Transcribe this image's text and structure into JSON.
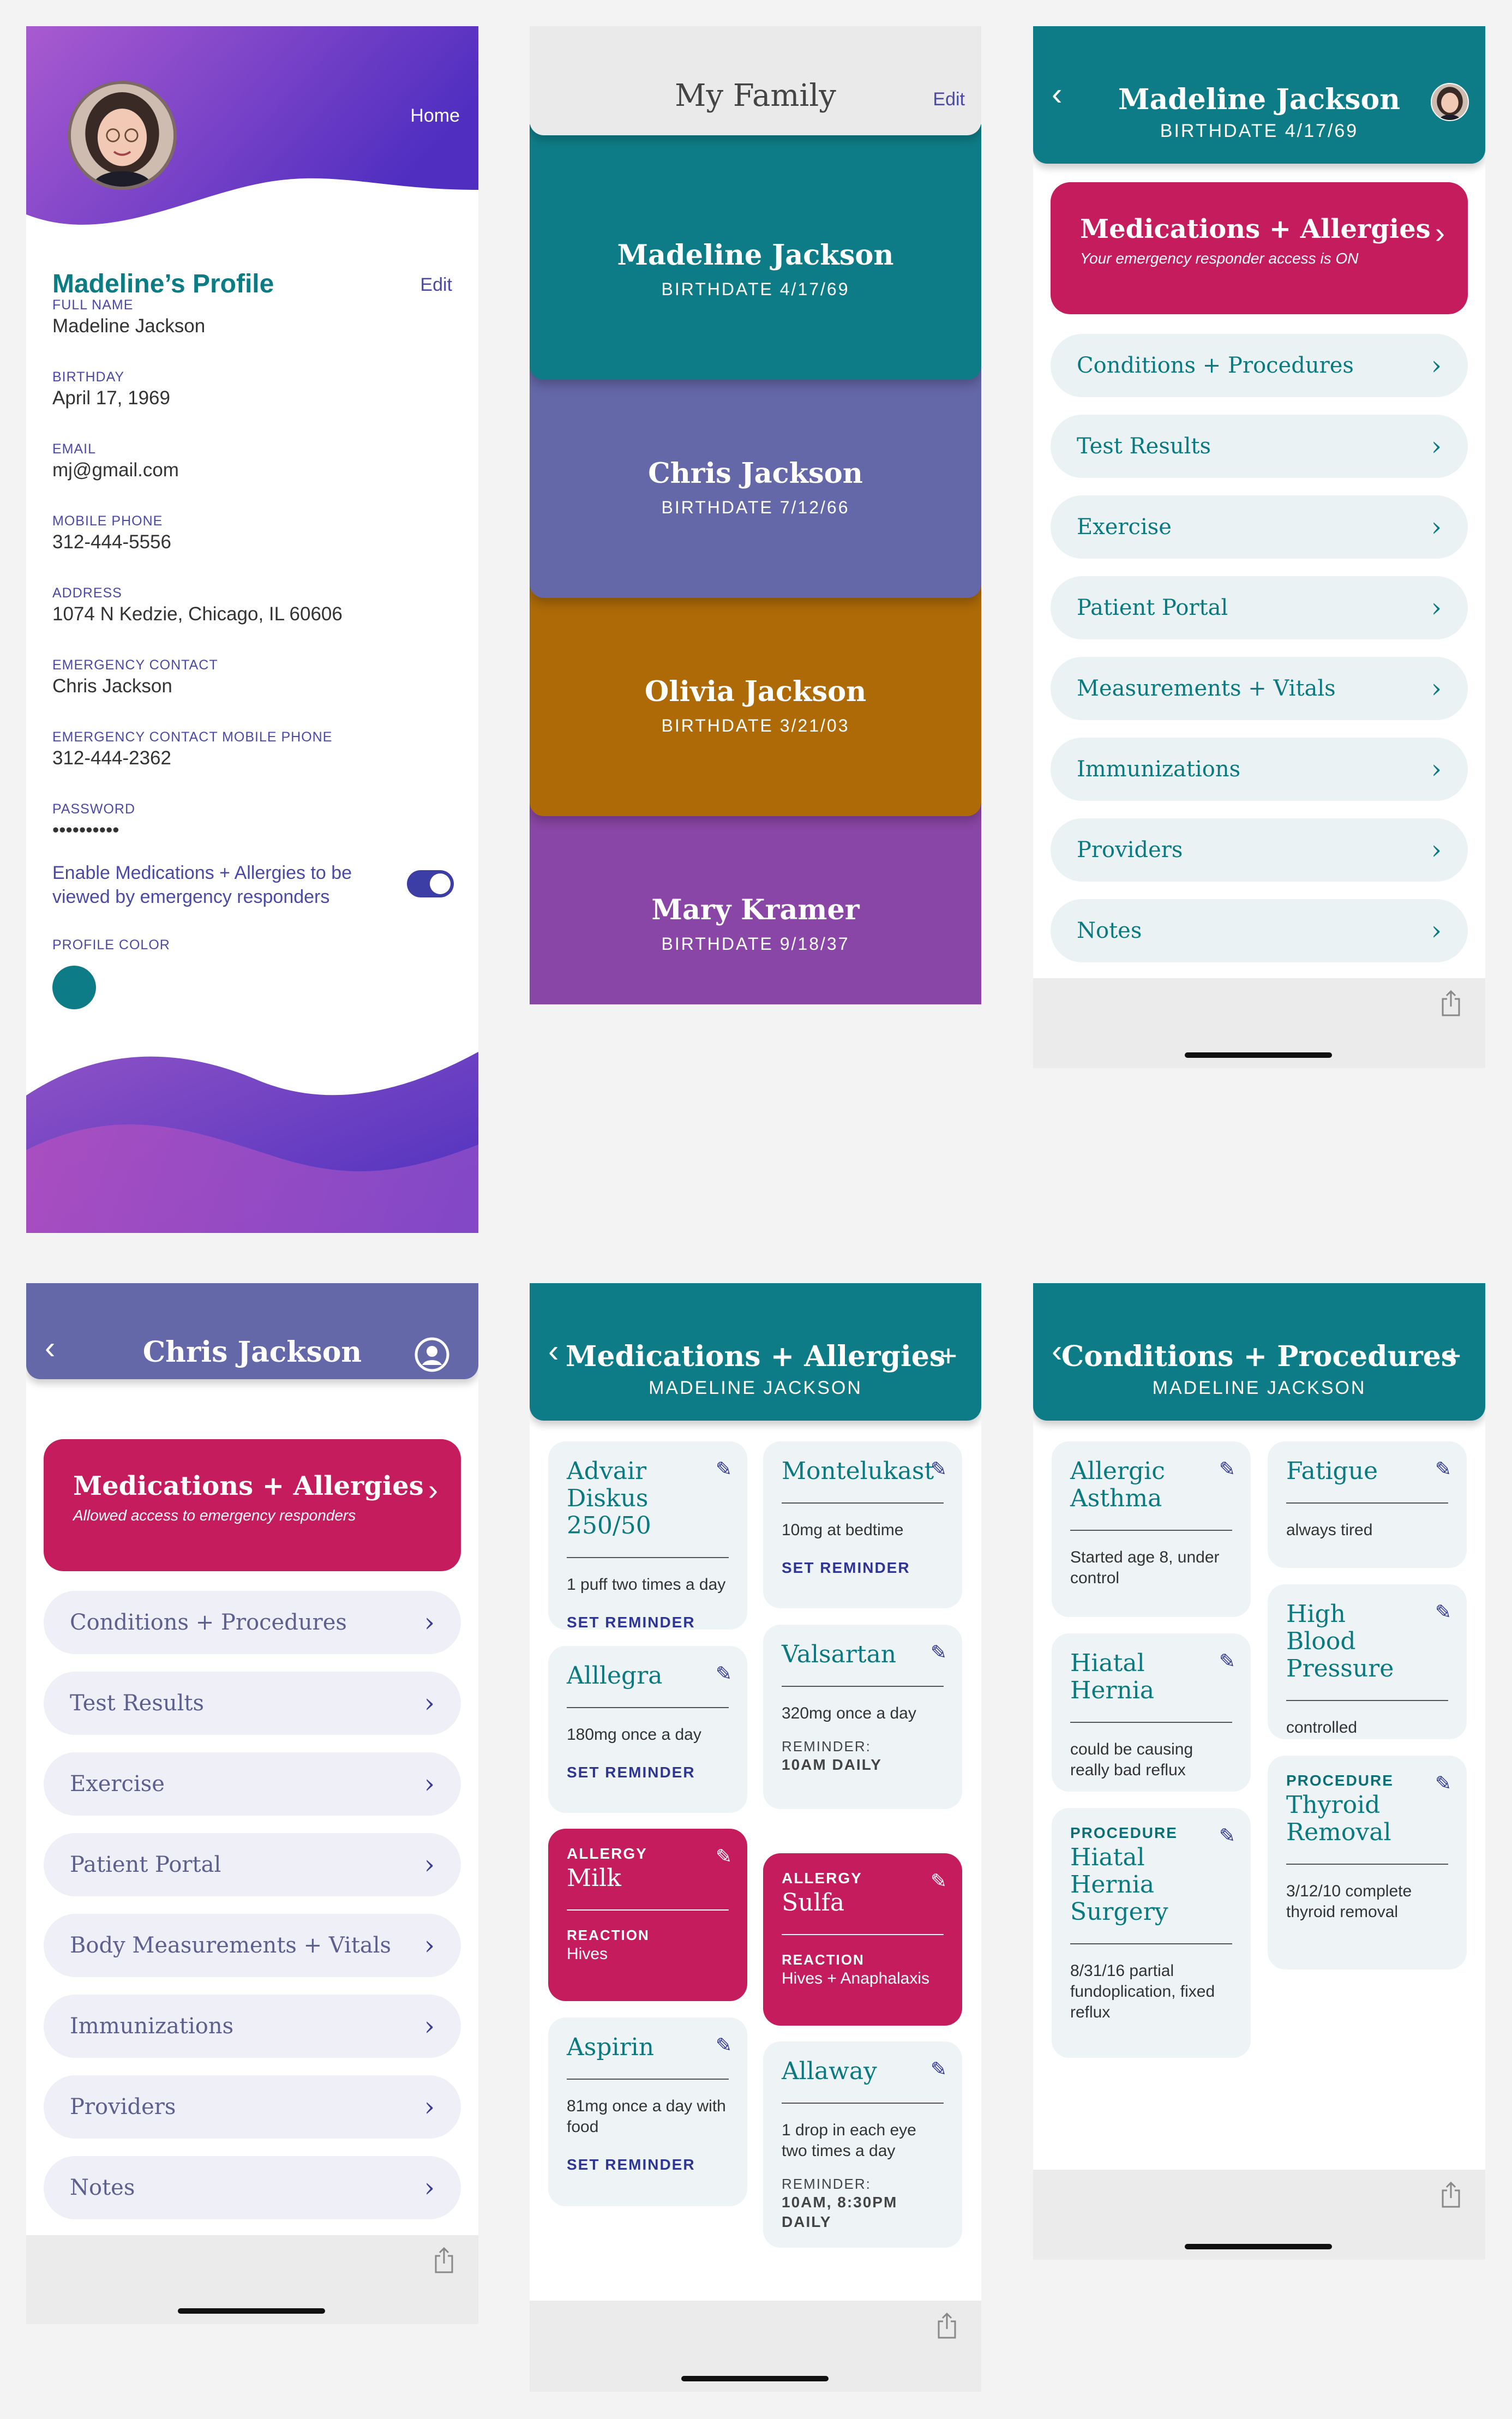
{
  "colors": {
    "teal": "#0e7c86",
    "indigo": "#6467a8",
    "amber": "#ad6a07",
    "purple": "#8a46a6",
    "magenta": "#c51c5d",
    "pill_teal": "#eaf2f3",
    "pill_lavender": "#eeeff7",
    "link": "#4a4aa6"
  },
  "profile": {
    "home_link": "Home",
    "title": "Madeline’s Profile",
    "edit_label": "Edit",
    "fields": [
      {
        "label": "FULL NAME",
        "value": "Madeline Jackson"
      },
      {
        "label": "BIRTHDAY",
        "value": "April 17, 1969"
      },
      {
        "label": "EMAIL",
        "value": "mj@gmail.com"
      },
      {
        "label": "MOBILE PHONE",
        "value": "312-444-5556"
      },
      {
        "label": "ADDRESS",
        "value": "1074  N Kedzie, Chicago, IL 60606"
      },
      {
        "label": "EMERGENCY CONTACT",
        "value": "Chris Jackson"
      },
      {
        "label": "EMERGENCY CONTACT MOBILE PHONE",
        "value": "312-444-2362"
      },
      {
        "label": "PASSWORD",
        "value": "••••••••••"
      }
    ],
    "enable_text": "Enable Medications + Allergies to be viewed by emergency responders",
    "toggle_on": true,
    "profile_color_label": "PROFILE COLOR",
    "profile_color": "#0e7c86"
  },
  "family": {
    "title": "My Family",
    "edit_label": "Edit",
    "members": [
      {
        "name": "Madeline Jackson",
        "birthdate": "BIRTHDATE 4/17/69",
        "color": "#0e7c86"
      },
      {
        "name": "Chris Jackson",
        "birthdate": "BIRTHDATE 7/12/66",
        "color": "#6467a8"
      },
      {
        "name": "Olivia Jackson",
        "birthdate": "BIRTHDATE 3/21/03",
        "color": "#ad6a07"
      },
      {
        "name": "Mary Kramer",
        "birthdate": "BIRTHDATE 9/18/37",
        "color": "#8a46a6"
      }
    ]
  },
  "madeline_menu": {
    "title": "Madeline Jackson",
    "subtitle": "BIRTHDATE 4/17/69",
    "hero_title": "Medications + Allergies",
    "hero_sub": "Your emergency responder access is ON",
    "items": [
      "Conditions + Procedures",
      "Test Results",
      "Exercise",
      "Patient Portal",
      "Measurements + Vitals",
      "Immunizations",
      "Providers",
      "Notes"
    ]
  },
  "chris_menu": {
    "title": "Chris Jackson",
    "hero_title": "Medications + Allergies",
    "hero_sub": "Allowed access to emergency responders",
    "items": [
      "Conditions + Procedures",
      "Test Results",
      "Exercise",
      "Patient Portal",
      "Body Measurements + Vitals",
      "Immunizations",
      "Providers",
      "Notes"
    ]
  },
  "medications": {
    "title": "Medications + Allergies",
    "subtitle": "MADELINE JACKSON",
    "set_reminder": "SET REMINDER",
    "reminder_label": "REMINDER:",
    "left": [
      {
        "name": "Advair Diskus 250/50",
        "detail": "1 puff two times a day"
      },
      {
        "name": "Alllegra",
        "detail": "180mg once a day"
      },
      {
        "tag": "ALLERGY",
        "name": "Milk",
        "reaction_label": "REACTION",
        "reaction": "Hives"
      },
      {
        "name": "Aspirin",
        "detail": "81mg once a day with food"
      }
    ],
    "right": [
      {
        "name": "Montelukast",
        "detail": "10mg at bedtime"
      },
      {
        "name": "Valsartan",
        "detail": "320mg once a day",
        "reminder": "10AM DAILY"
      },
      {
        "tag": "ALLERGY",
        "name": "Sulfa",
        "reaction_label": "REACTION",
        "reaction": "Hives + Anaphalaxis"
      },
      {
        "name": "Allaway",
        "detail": "1 drop in each eye two times a day",
        "reminder": "10AM, 8:30PM DAILY"
      }
    ]
  },
  "conditions": {
    "title": "Conditions + Procedures",
    "subtitle": "MADELINE JACKSON",
    "left": [
      {
        "name": "Allergic Asthma",
        "detail": "Started age 8, under control"
      },
      {
        "name": "Hiatal Hernia",
        "detail": "could be causing really bad reflux"
      },
      {
        "tag": "PROCEDURE",
        "name": "Hiatal Hernia Surgery",
        "detail": "8/31/16 partial fundoplication, fixed reflux"
      }
    ],
    "right": [
      {
        "name": "Fatigue",
        "detail": "always tired"
      },
      {
        "name": "High Blood Pressure",
        "detail": "controlled"
      },
      {
        "tag": "PROCEDURE",
        "name": "Thyroid Removal",
        "detail": "3/12/10 complete thyroid removal"
      }
    ]
  },
  "icons": [
    "chevron-left-icon",
    "chevron-right-icon",
    "pencil-icon",
    "plus-icon",
    "share-icon",
    "user-circle-icon"
  ]
}
